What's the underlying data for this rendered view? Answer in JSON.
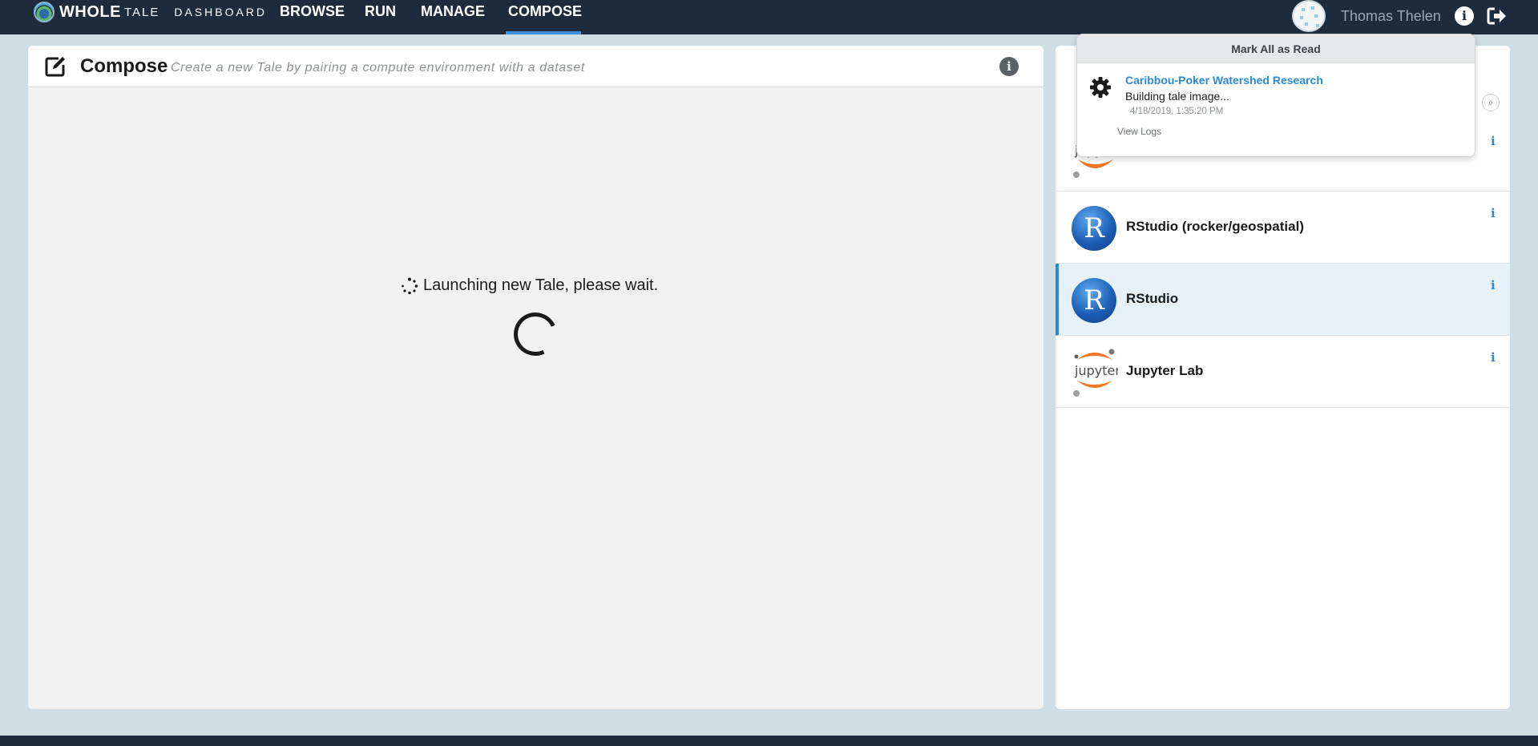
{
  "logo": {
    "whole": "WHOLE",
    "tale": "TALE",
    "dashboard": "DASHBOARD"
  },
  "nav": {
    "browse": "BROWSE",
    "run": "RUN",
    "manage": "MANAGE",
    "compose": "COMPOSE",
    "active": "COMPOSE"
  },
  "user": {
    "name": "Thomas Thelen"
  },
  "compose": {
    "title": "Compose",
    "subtitle": "Create a new Tale by pairing a compute environment with a dataset",
    "launching": "Launching new Tale, please wait."
  },
  "environments": [
    {
      "name": "",
      "logo": "jupyter-logo",
      "selected": false
    },
    {
      "name": "RStudio (rocker/geospatial)",
      "logo": "r-logo",
      "selected": false
    },
    {
      "name": "RStudio",
      "logo": "r-logo",
      "selected": true
    },
    {
      "name": "Jupyter Lab",
      "logo": "jupyter-logo",
      "selected": false
    }
  ],
  "notifications": {
    "mark_all": "Mark All as Read",
    "items": [
      {
        "title": "Caribbou-Poker Watershed Research",
        "message": "Building tale image...",
        "time": "4/18/2019, 1:35:20 PM",
        "logs": "View Logs"
      }
    ]
  },
  "icons": {
    "info": "i",
    "search": "⌕"
  },
  "colors": {
    "nav_bg": "#1e2b3d",
    "accent": "#2b8ad8",
    "selected_bg": "#e6f1f8",
    "page_bg": "#cfdde4"
  }
}
